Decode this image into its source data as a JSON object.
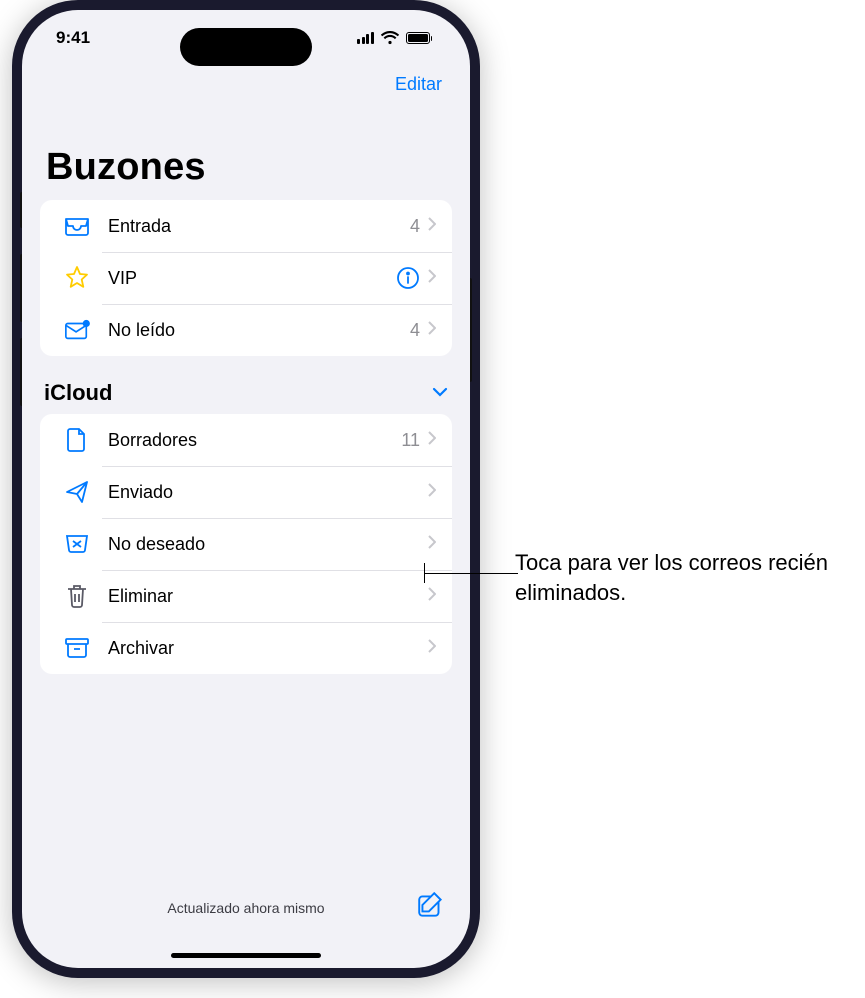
{
  "status": {
    "time": "9:41"
  },
  "nav": {
    "edit": "Editar"
  },
  "title": "Buzones",
  "top_group": [
    {
      "icon": "tray",
      "label": "Entrada",
      "count": "4",
      "info": false
    },
    {
      "icon": "star",
      "label": "VIP",
      "count": "",
      "info": true
    },
    {
      "icon": "unread",
      "label": "No leído",
      "count": "4",
      "info": false
    }
  ],
  "section": {
    "title": "iCloud"
  },
  "icloud_group": [
    {
      "icon": "doc",
      "label": "Borradores",
      "count": "11"
    },
    {
      "icon": "plane",
      "label": "Enviado",
      "count": ""
    },
    {
      "icon": "junk",
      "label": "No deseado",
      "count": ""
    },
    {
      "icon": "trash",
      "label": "Eliminar",
      "count": ""
    },
    {
      "icon": "archive",
      "label": "Archivar",
      "count": ""
    }
  ],
  "bottom": {
    "status": "Actualizado ahora mismo"
  },
  "callout": "Toca para ver los correos recién eliminados.",
  "colors": {
    "accent": "#007aff",
    "star": "#ffcc00",
    "gray_icon": "#5a5a66"
  }
}
